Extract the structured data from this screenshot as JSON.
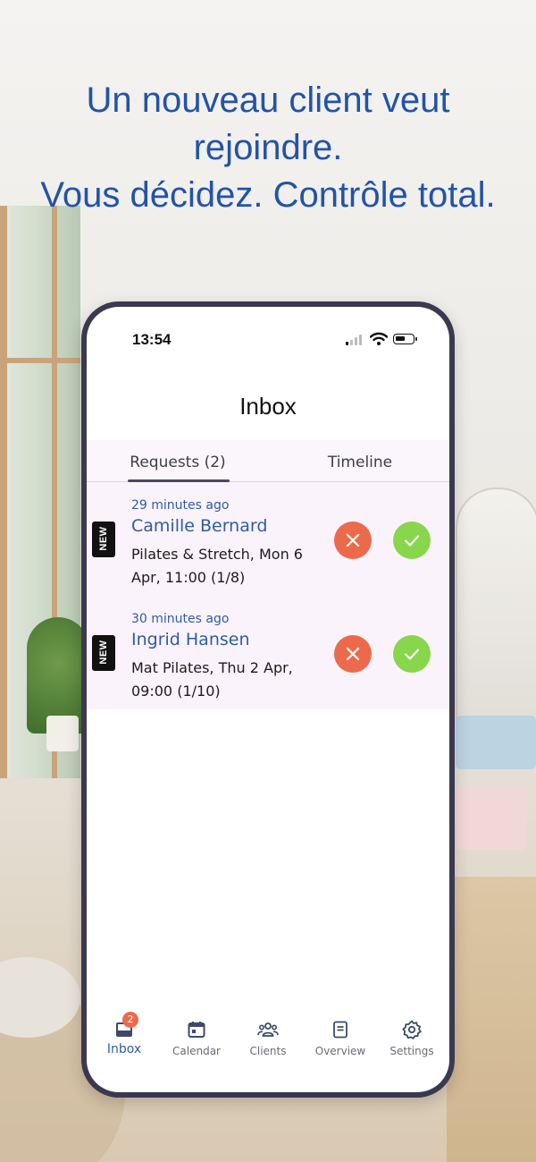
{
  "hero": {
    "line1": "Un nouveau client veut",
    "line2": "rejoindre.",
    "line3": "Vous décidez. Contrôle total."
  },
  "status_bar": {
    "time": "13:54",
    "icons": [
      "signal-icon",
      "wifi-icon",
      "battery-icon"
    ]
  },
  "screen": {
    "title": "Inbox"
  },
  "tabs": [
    {
      "label": "Requests (2)",
      "selected": true
    },
    {
      "label": "Timeline",
      "selected": false
    }
  ],
  "requests": [
    {
      "badge": "NEW",
      "time": "29 minutes ago",
      "name": "Camille Bernard",
      "detail": "Pilates & Stretch, Mon 6 Apr, 11:00 (1/8)"
    },
    {
      "badge": "NEW",
      "time": "30 minutes ago",
      "name": "Ingrid Hansen",
      "detail": "Mat Pilates, Thu 2 Apr, 09:00 (1/10)"
    }
  ],
  "nav": {
    "items": [
      {
        "label": "Inbox",
        "icon": "inbox-icon",
        "badge": "2",
        "active": true
      },
      {
        "label": "Calendar",
        "icon": "calendar-icon"
      },
      {
        "label": "Clients",
        "icon": "clients-icon"
      },
      {
        "label": "Overview",
        "icon": "overview-icon"
      },
      {
        "label": "Settings",
        "icon": "gear-icon"
      }
    ]
  },
  "colors": {
    "hero_text": "#2353a7",
    "accent_blue": "#2f5ca3",
    "reject": "#ec6a4c",
    "accept": "#88d64b",
    "phone_frame": "#3b3950"
  }
}
